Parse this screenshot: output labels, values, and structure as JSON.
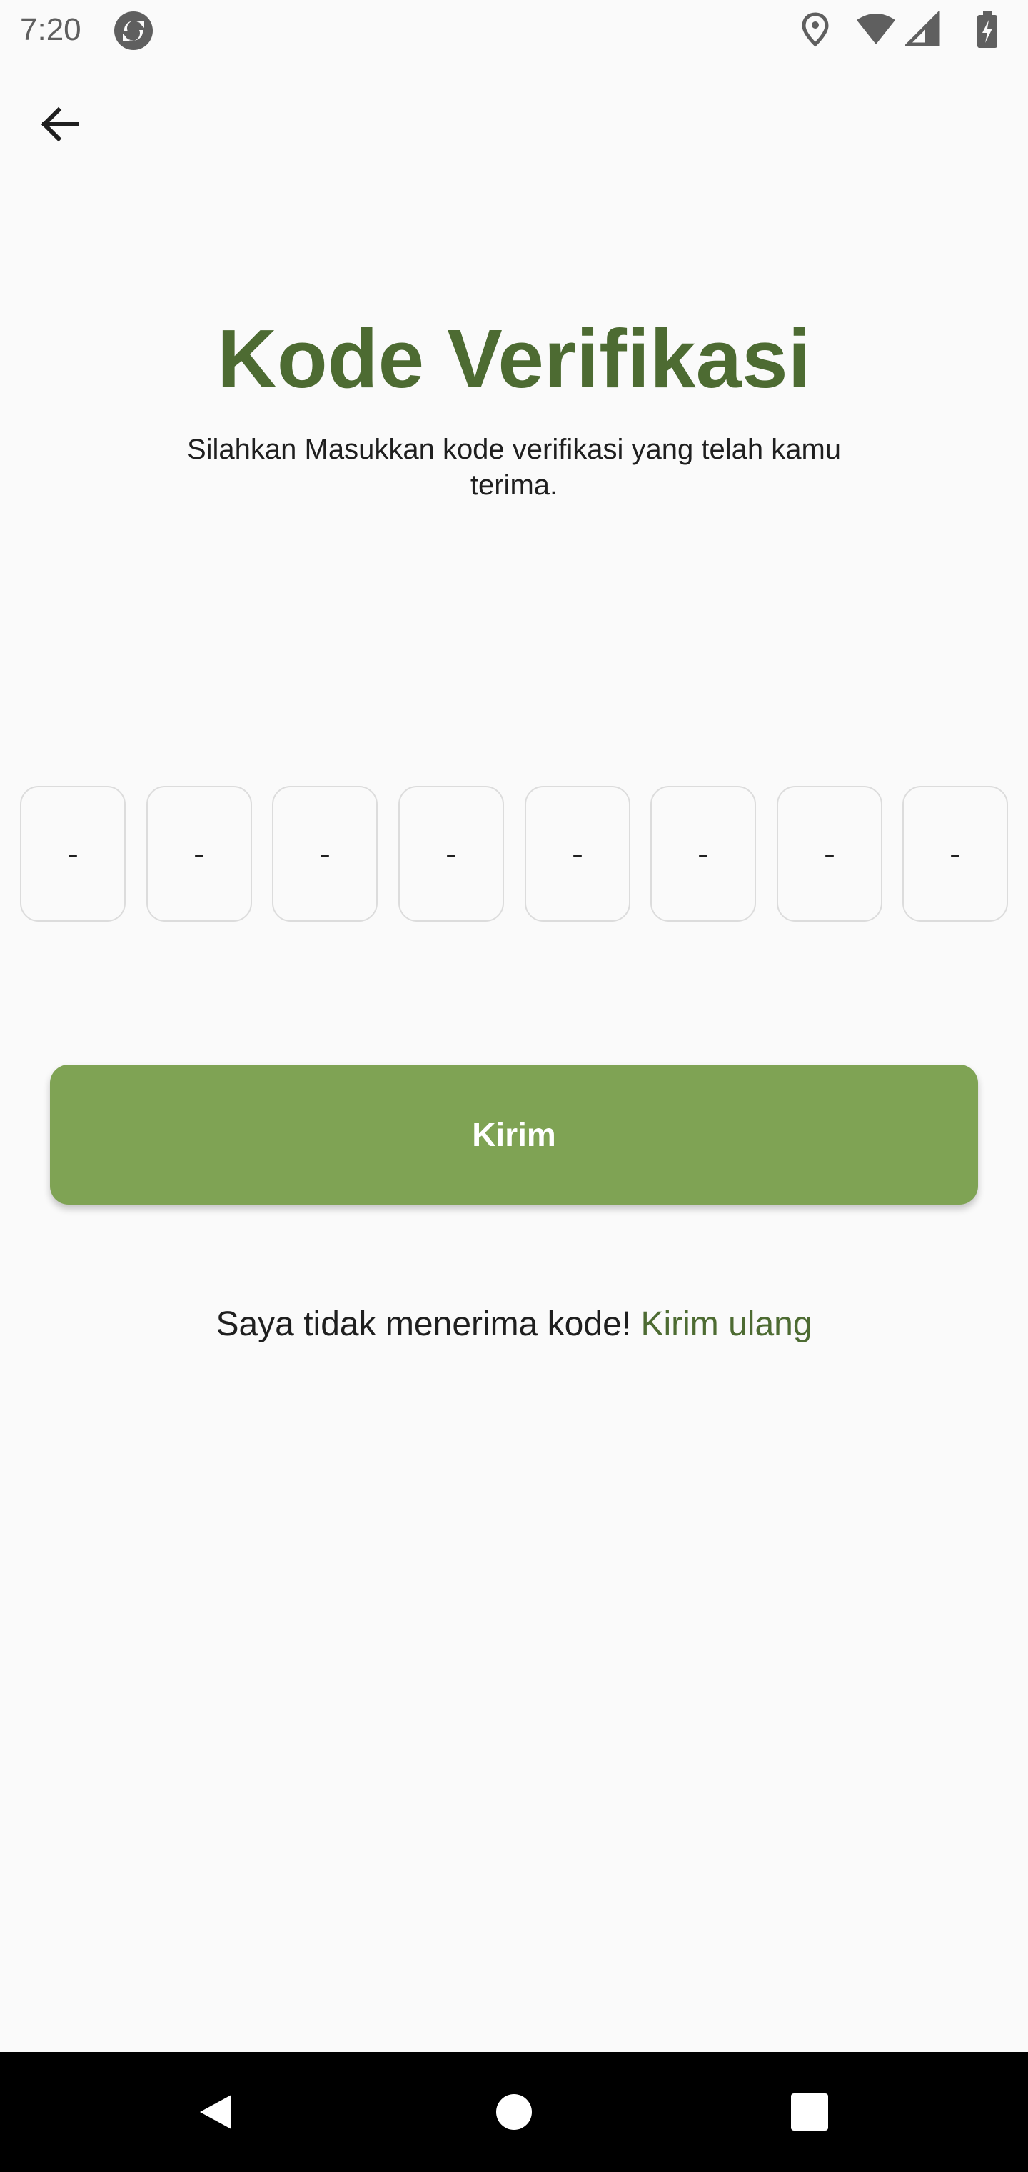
{
  "status_bar": {
    "time": "7:20",
    "icons": [
      "app-sync-icon",
      "location-icon",
      "wifi-icon",
      "signal-icon",
      "battery-charging-icon"
    ]
  },
  "header": {
    "back_icon": "arrow-back-icon"
  },
  "main": {
    "title": "Kode Verifikasi",
    "subtitle": "Silahkan Masukkan kode verifikasi yang telah kamu terima.",
    "otp_boxes": [
      "-",
      "-",
      "-",
      "-",
      "-",
      "-",
      "-",
      "-"
    ],
    "submit_label": "Kirim",
    "resend_prompt": "Saya tidak menerima kode! ",
    "resend_link": "Kirim ulang"
  },
  "nav_bar": {
    "icons": [
      "back-triangle-icon",
      "home-circle-icon",
      "recents-square-icon"
    ]
  },
  "colors": {
    "title": "#4d6b32",
    "button": "#7fa354",
    "link": "#4d6b32",
    "background": "#fafafa"
  }
}
